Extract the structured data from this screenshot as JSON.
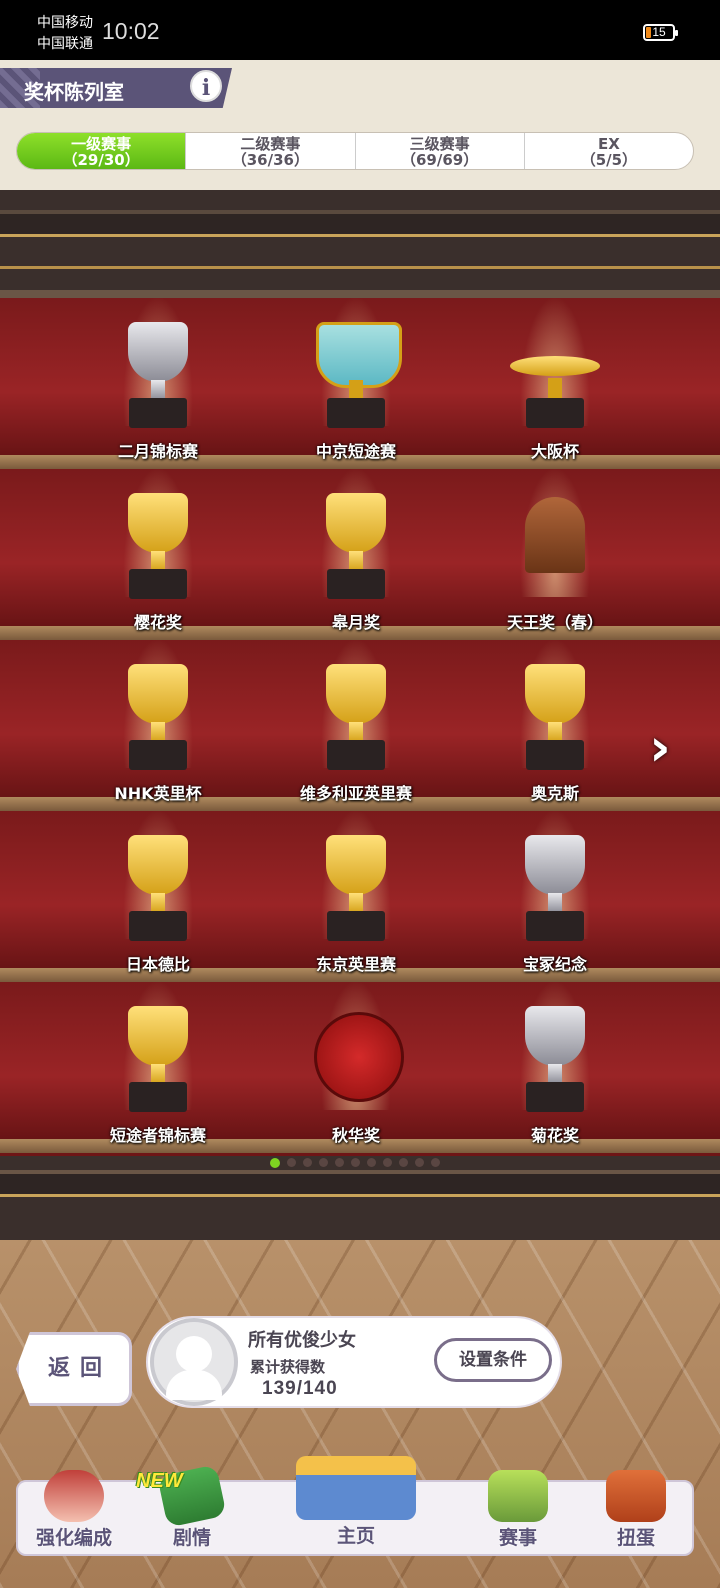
{
  "status_bar": {
    "carrier1": "中国移动",
    "carrier2": "中国联通",
    "time": "10:02",
    "battery": "15"
  },
  "header": {
    "title": "奖杯陈列室",
    "info_label": "i"
  },
  "tabs": [
    {
      "label": "一级赛事",
      "count": "（29/30）",
      "active": true
    },
    {
      "label": "二级赛事",
      "count": "（36/36）",
      "active": false
    },
    {
      "label": "三级赛事",
      "count": "（69/69）",
      "active": false
    },
    {
      "label": "EX",
      "count": "（5/5）",
      "active": false
    }
  ],
  "trophies": [
    {
      "name": "二月锦标赛",
      "style": "silver"
    },
    {
      "name": "中京短途赛",
      "style": "vase"
    },
    {
      "name": "大阪杯",
      "style": "dish"
    },
    {
      "name": "樱花奖",
      "style": "gold"
    },
    {
      "name": "皋月奖",
      "style": "gold"
    },
    {
      "name": "天王奖（春）",
      "style": "bronze"
    },
    {
      "name": "NHK英里杯",
      "style": "gold"
    },
    {
      "name": "维多利亚英里赛",
      "style": "gold"
    },
    {
      "name": "奥克斯",
      "style": "gold"
    },
    {
      "name": "日本德比",
      "style": "gold"
    },
    {
      "name": "东京英里赛",
      "style": "gold"
    },
    {
      "name": "宝冢纪念",
      "style": "silver"
    },
    {
      "name": "短途者锦标赛",
      "style": "gold"
    },
    {
      "name": "秋华奖",
      "style": "plate"
    },
    {
      "name": "菊花奖",
      "style": "silver"
    }
  ],
  "pagination": {
    "total": 11,
    "current": 1
  },
  "next_arrow": "›",
  "back_button": "返回",
  "summary": {
    "title": "所有优俊少女",
    "subtitle": "累计获得数",
    "count": "139/140",
    "condition_button": "设置条件"
  },
  "nav": {
    "items": [
      "强化编成",
      "剧情",
      "主页",
      "赛事",
      "扭蛋"
    ],
    "new_badge": "NEW"
  },
  "colors": {
    "accent_green": "#7ed321",
    "shelf_red": "#9a2426",
    "brand_purple": "#5b5478"
  }
}
